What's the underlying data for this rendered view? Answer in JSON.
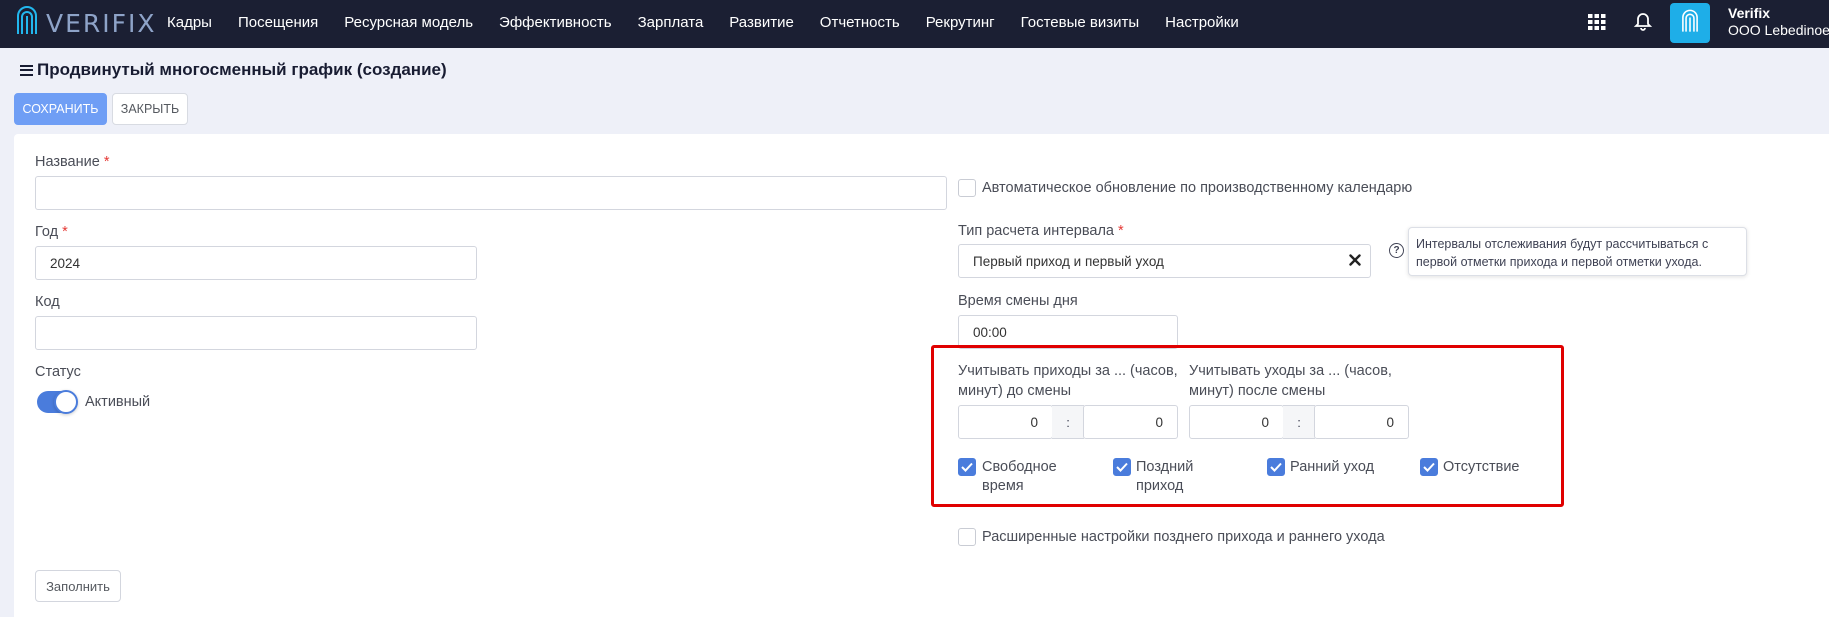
{
  "app": {
    "logo_text": "VERIFIX"
  },
  "nav": [
    "Кадры",
    "Посещения",
    "Ресурсная модель",
    "Эффективность",
    "Зарплата",
    "Развитие",
    "Отчетность",
    "Рекрутинг",
    "Гостевые визиты",
    "Настройки"
  ],
  "user": {
    "name": "Verifix",
    "org": "OOO Lebedinoe"
  },
  "page": {
    "title": "Продвинутый многосменный график (создание)"
  },
  "toolbar": {
    "save_label": "СОХРАНИТЬ",
    "close_label": "ЗАКРЫТЬ"
  },
  "form": {
    "name": {
      "label": "Название",
      "required": "*",
      "value": ""
    },
    "year": {
      "label": "Год",
      "required": "*",
      "value": "2024"
    },
    "code": {
      "label": "Код",
      "value": ""
    },
    "status": {
      "label": "Статус",
      "value": "Активный",
      "on": true
    },
    "auto_update": {
      "label": "Автоматическое обновление по производственному календарю",
      "checked": false
    },
    "interval_type": {
      "label": "Тип расчета интервала",
      "required": "*",
      "value": "Первый приход и первый уход",
      "tooltip": "Интервалы отслеживания будут рассчитываться с первой отметки прихода и первой отметки ухода."
    },
    "day_change": {
      "label": "Время смены дня",
      "value": "00:00"
    },
    "arrivals": {
      "label_line1": "Учитывать приходы за ... (часов,",
      "label_line2": "минут) до смены",
      "hours": "0",
      "minutes": "0",
      "separator": ":"
    },
    "departures": {
      "label_line1": "Учитывать уходы за ... (часов,",
      "label_line2": "минут) после смены",
      "hours": "0",
      "minutes": "0",
      "separator": ":"
    },
    "checks": [
      {
        "line1": "Свободное",
        "line2": "время",
        "checked": true
      },
      {
        "line1": "Поздний",
        "line2": "приход",
        "checked": true
      },
      {
        "line1": "Ранний уход",
        "line2": "",
        "checked": true
      },
      {
        "line1": "Отсутствие",
        "line2": "",
        "checked": true
      }
    ],
    "extended": {
      "label": "Расширенные настройки позднего прихода и раннего ухода",
      "checked": false
    },
    "fill_label": "Заполнить"
  },
  "colors": {
    "topbar": "#1b1f33",
    "accent": "#4a7cdc",
    "save_button": "#6f9ef5",
    "highlight_box": "#e00000"
  }
}
